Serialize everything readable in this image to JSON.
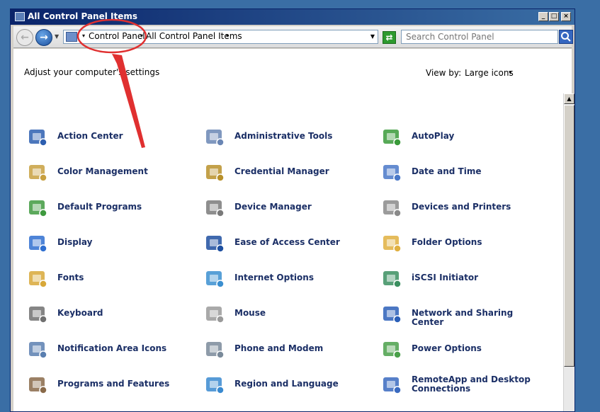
{
  "window": {
    "title": "All Control Panel Items"
  },
  "titlebar_buttons": {
    "minimize": "_",
    "maximize": "□",
    "close": "×"
  },
  "address": {
    "crumbs": [
      "Control Panel",
      "All Control Panel Items"
    ],
    "arrow": "▾"
  },
  "search": {
    "placeholder": "Search Control Panel"
  },
  "header": {
    "heading": "Adjust your computer's settings",
    "view_by_label": "View by:",
    "view_by_value": "Large icons",
    "view_by_arrow": "▾"
  },
  "items": [
    {
      "label": "Action Center",
      "icon": "flag-icon",
      "color": "#2d5fb0"
    },
    {
      "label": "Administrative Tools",
      "icon": "admin-tools-icon",
      "color": "#6a86b4"
    },
    {
      "label": "AutoPlay",
      "icon": "autoplay-icon",
      "color": "#3a9a3a"
    },
    {
      "label": "Color Management",
      "icon": "color-management-icon",
      "color": "#c8a040"
    },
    {
      "label": "Credential Manager",
      "icon": "vault-icon",
      "color": "#b8902a"
    },
    {
      "label": "Date and Time",
      "icon": "calendar-clock-icon",
      "color": "#4a78c8"
    },
    {
      "label": "Default Programs",
      "icon": "default-programs-icon",
      "color": "#3f9a3f"
    },
    {
      "label": "Device Manager",
      "icon": "device-manager-icon",
      "color": "#7a7a7a"
    },
    {
      "label": "Devices and Printers",
      "icon": "printer-icon",
      "color": "#8a8a8a"
    },
    {
      "label": "Display",
      "icon": "monitor-icon",
      "color": "#2f6fd0"
    },
    {
      "label": "Ease of Access Center",
      "icon": "accessibility-icon",
      "color": "#1e4fa0"
    },
    {
      "label": "Folder Options",
      "icon": "folder-icon",
      "color": "#e0b040"
    },
    {
      "label": "Fonts",
      "icon": "fonts-folder-icon",
      "color": "#d8a838"
    },
    {
      "label": "Internet Options",
      "icon": "globe-icon",
      "color": "#3b8fd0"
    },
    {
      "label": "iSCSI Initiator",
      "icon": "iscsi-globe-icon",
      "color": "#3b8f60"
    },
    {
      "label": "Keyboard",
      "icon": "keyboard-icon",
      "color": "#707070"
    },
    {
      "label": "Mouse",
      "icon": "mouse-icon",
      "color": "#9a9a9a"
    },
    {
      "label": "Network and Sharing Center",
      "icon": "network-icon",
      "color": "#2b5fb8"
    },
    {
      "label": "Notification Area Icons",
      "icon": "notification-area-icon",
      "color": "#5a7fb0"
    },
    {
      "label": "Phone and Modem",
      "icon": "phone-icon",
      "color": "#7a8a9a"
    },
    {
      "label": "Power Options",
      "icon": "battery-icon",
      "color": "#4aa04a"
    },
    {
      "label": "Programs and Features",
      "icon": "programs-icon",
      "color": "#8a6a4a"
    },
    {
      "label": "Region and Language",
      "icon": "region-globe-icon",
      "color": "#3a8ad0"
    },
    {
      "label": "RemoteApp and Desktop Connections",
      "icon": "remoteapp-icon",
      "color": "#3a6ac0"
    }
  ]
}
